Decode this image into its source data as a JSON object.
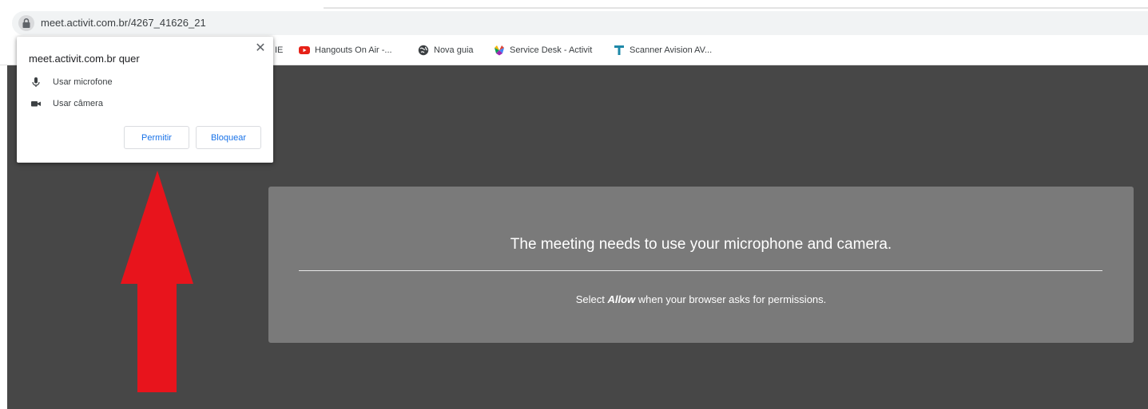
{
  "browser": {
    "url": "meet.activit.com.br/4267_41626_21",
    "bookmarks": [
      {
        "label": "IE",
        "icon": "bookmark-favicon"
      },
      {
        "label": "Hangouts On Air -...",
        "icon": "youtube-icon"
      },
      {
        "label": "Nova guia",
        "icon": "globe-icon"
      },
      {
        "label": "Service Desk - Activit",
        "icon": "service-desk-icon"
      },
      {
        "label": "Scanner Avision AV...",
        "icon": "t-logo-icon"
      }
    ]
  },
  "permission_popup": {
    "title": "meet.activit.com.br quer",
    "permissions": [
      {
        "label": "Usar microfone",
        "icon": "microphone-icon"
      },
      {
        "label": "Usar câmera",
        "icon": "camera-icon"
      }
    ],
    "allow_label": "Permitir",
    "block_label": "Bloquear",
    "close_glyph": "✕"
  },
  "meeting_notice": {
    "title": "The meeting needs to use your microphone and camera.",
    "body_prefix": "Select ",
    "body_emphasis": "Allow",
    "body_suffix": " when your browser asks for permissions."
  },
  "colors": {
    "page_background": "#474747",
    "notice_panel": "#7a7a7a",
    "annotation_arrow": "#e8141c",
    "button_text": "#1a73e8"
  }
}
